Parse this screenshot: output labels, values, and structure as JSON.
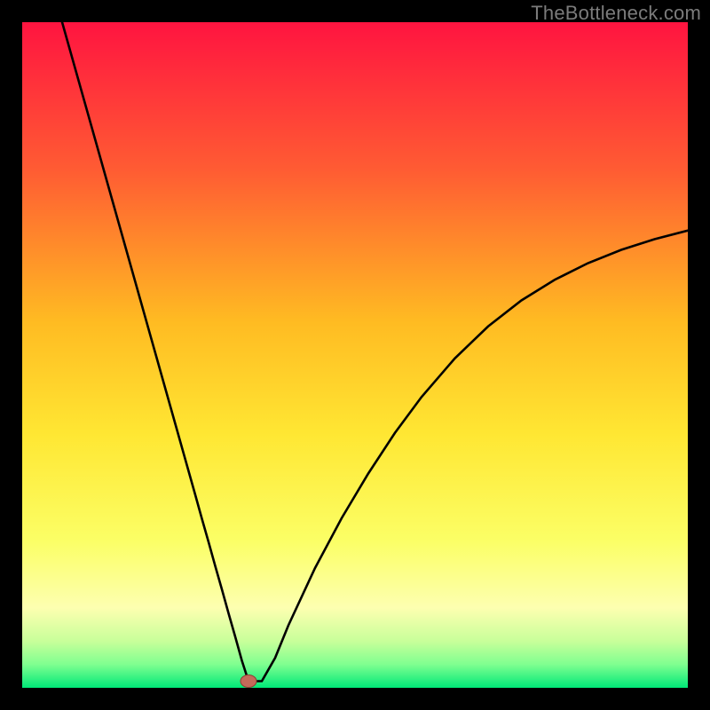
{
  "watermark": "TheBottleneck.com",
  "colors": {
    "frame": "#000000",
    "watermark_text": "#7b7b7b",
    "curve": "#000000",
    "marker_fill": "#c46a5a",
    "marker_stroke": "#8e4034",
    "gradient_stops": [
      {
        "offset": 0.0,
        "color": "#ff1440"
      },
      {
        "offset": 0.22,
        "color": "#ff5b33"
      },
      {
        "offset": 0.45,
        "color": "#ffbb22"
      },
      {
        "offset": 0.62,
        "color": "#ffe733"
      },
      {
        "offset": 0.78,
        "color": "#fbff66"
      },
      {
        "offset": 0.88,
        "color": "#fdffb0"
      },
      {
        "offset": 0.93,
        "color": "#c8ff9a"
      },
      {
        "offset": 0.965,
        "color": "#7fff90"
      },
      {
        "offset": 1.0,
        "color": "#00e878"
      }
    ]
  },
  "chart_data": {
    "type": "line",
    "title": "",
    "xlabel": "",
    "ylabel": "",
    "xlim": [
      0,
      100
    ],
    "ylim": [
      0,
      100
    ],
    "grid": false,
    "legend": false,
    "series": [
      {
        "name": "bottleneck-curve",
        "x": [
          6,
          8,
          10,
          12,
          14,
          16,
          18,
          20,
          22,
          24,
          26,
          27,
          28,
          29,
          30,
          31,
          32,
          33,
          34,
          36,
          38,
          40,
          44,
          48,
          52,
          56,
          60,
          65,
          70,
          75,
          80,
          85,
          90,
          95,
          100
        ],
        "y": [
          100,
          92.9,
          85.8,
          78.7,
          71.6,
          64.5,
          57.4,
          50.3,
          43.2,
          36.1,
          29.0,
          25.4,
          21.9,
          18.3,
          14.8,
          11.2,
          7.7,
          4.1,
          1.0,
          1.0,
          4.5,
          9.4,
          18.0,
          25.5,
          32.2,
          38.3,
          43.7,
          49.5,
          54.3,
          58.2,
          61.3,
          63.8,
          65.8,
          67.4,
          68.7
        ]
      }
    ],
    "marker": {
      "x": 34,
      "y": 1.0
    }
  }
}
